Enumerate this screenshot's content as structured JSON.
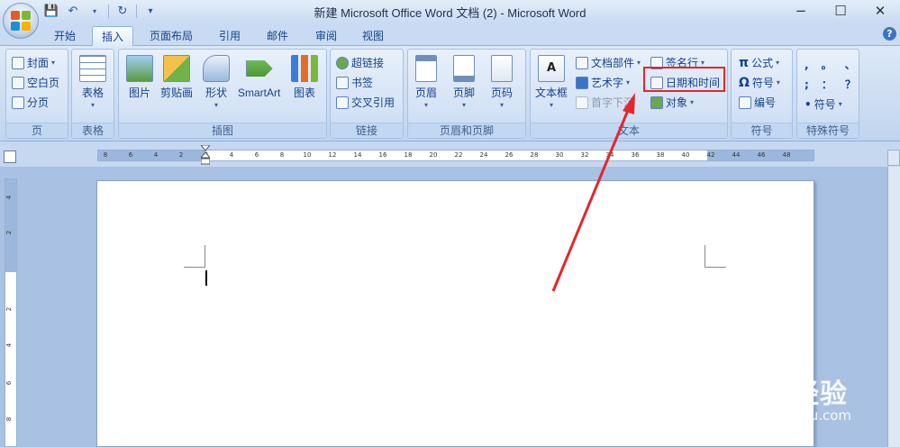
{
  "window": {
    "title": "新建 Microsoft Office Word 文档 (2) - Microsoft Word",
    "minimize": "−",
    "maximize": "☐",
    "close": "✕"
  },
  "qat": {
    "save": "💾",
    "undo": "↶",
    "redo": "↻",
    "customize": "▾"
  },
  "tabs": [
    "开始",
    "插入",
    "页面布局",
    "引用",
    "邮件",
    "审阅",
    "视图"
  ],
  "active_tab": "插入",
  "help": "?",
  "groups": {
    "page": {
      "label": "页",
      "items": [
        "封面",
        "空白页",
        "分页"
      ]
    },
    "table": {
      "label": "表格",
      "items": [
        "表格"
      ]
    },
    "illustrations": {
      "label": "插图",
      "items": [
        "图片",
        "剪贴画",
        "形状",
        "SmartArt",
        "图表"
      ]
    },
    "links": {
      "label": "链接",
      "items": [
        "超链接",
        "书签",
        "交叉引用"
      ]
    },
    "header_footer": {
      "label": "页眉和页脚",
      "items": [
        "页眉",
        "页脚",
        "页码"
      ]
    },
    "text": {
      "label": "文本",
      "items": [
        "文本框",
        "文档部件",
        "艺术字",
        "首字下沉",
        "签名行",
        "日期和时间",
        "对象"
      ]
    },
    "symbols": {
      "label": "符号",
      "items": [
        "公式",
        "符号",
        "编号"
      ]
    },
    "special": {
      "label": "特殊符号",
      "items": [
        ",",
        "。",
        "、",
        ";",
        "：",
        "？",
        "符号"
      ]
    }
  },
  "ruler": {
    "h_ticks": [
      "8",
      "6",
      "4",
      "2",
      "2",
      "4",
      "6",
      "8",
      "10",
      "12",
      "14",
      "16",
      "18",
      "20",
      "22",
      "24",
      "26",
      "28",
      "30",
      "32",
      "34",
      "36",
      "38",
      "40",
      "42",
      "44",
      "46",
      "48"
    ],
    "v_ticks": [
      "4",
      "2",
      "2",
      "4",
      "6",
      "8"
    ]
  },
  "watermark": {
    "brand": "Baidu经验",
    "url": "jingyan.baidu.com"
  },
  "colors": {
    "accent": "#15428b",
    "highlight": "#e4262b",
    "arrow": "#e4262b"
  }
}
